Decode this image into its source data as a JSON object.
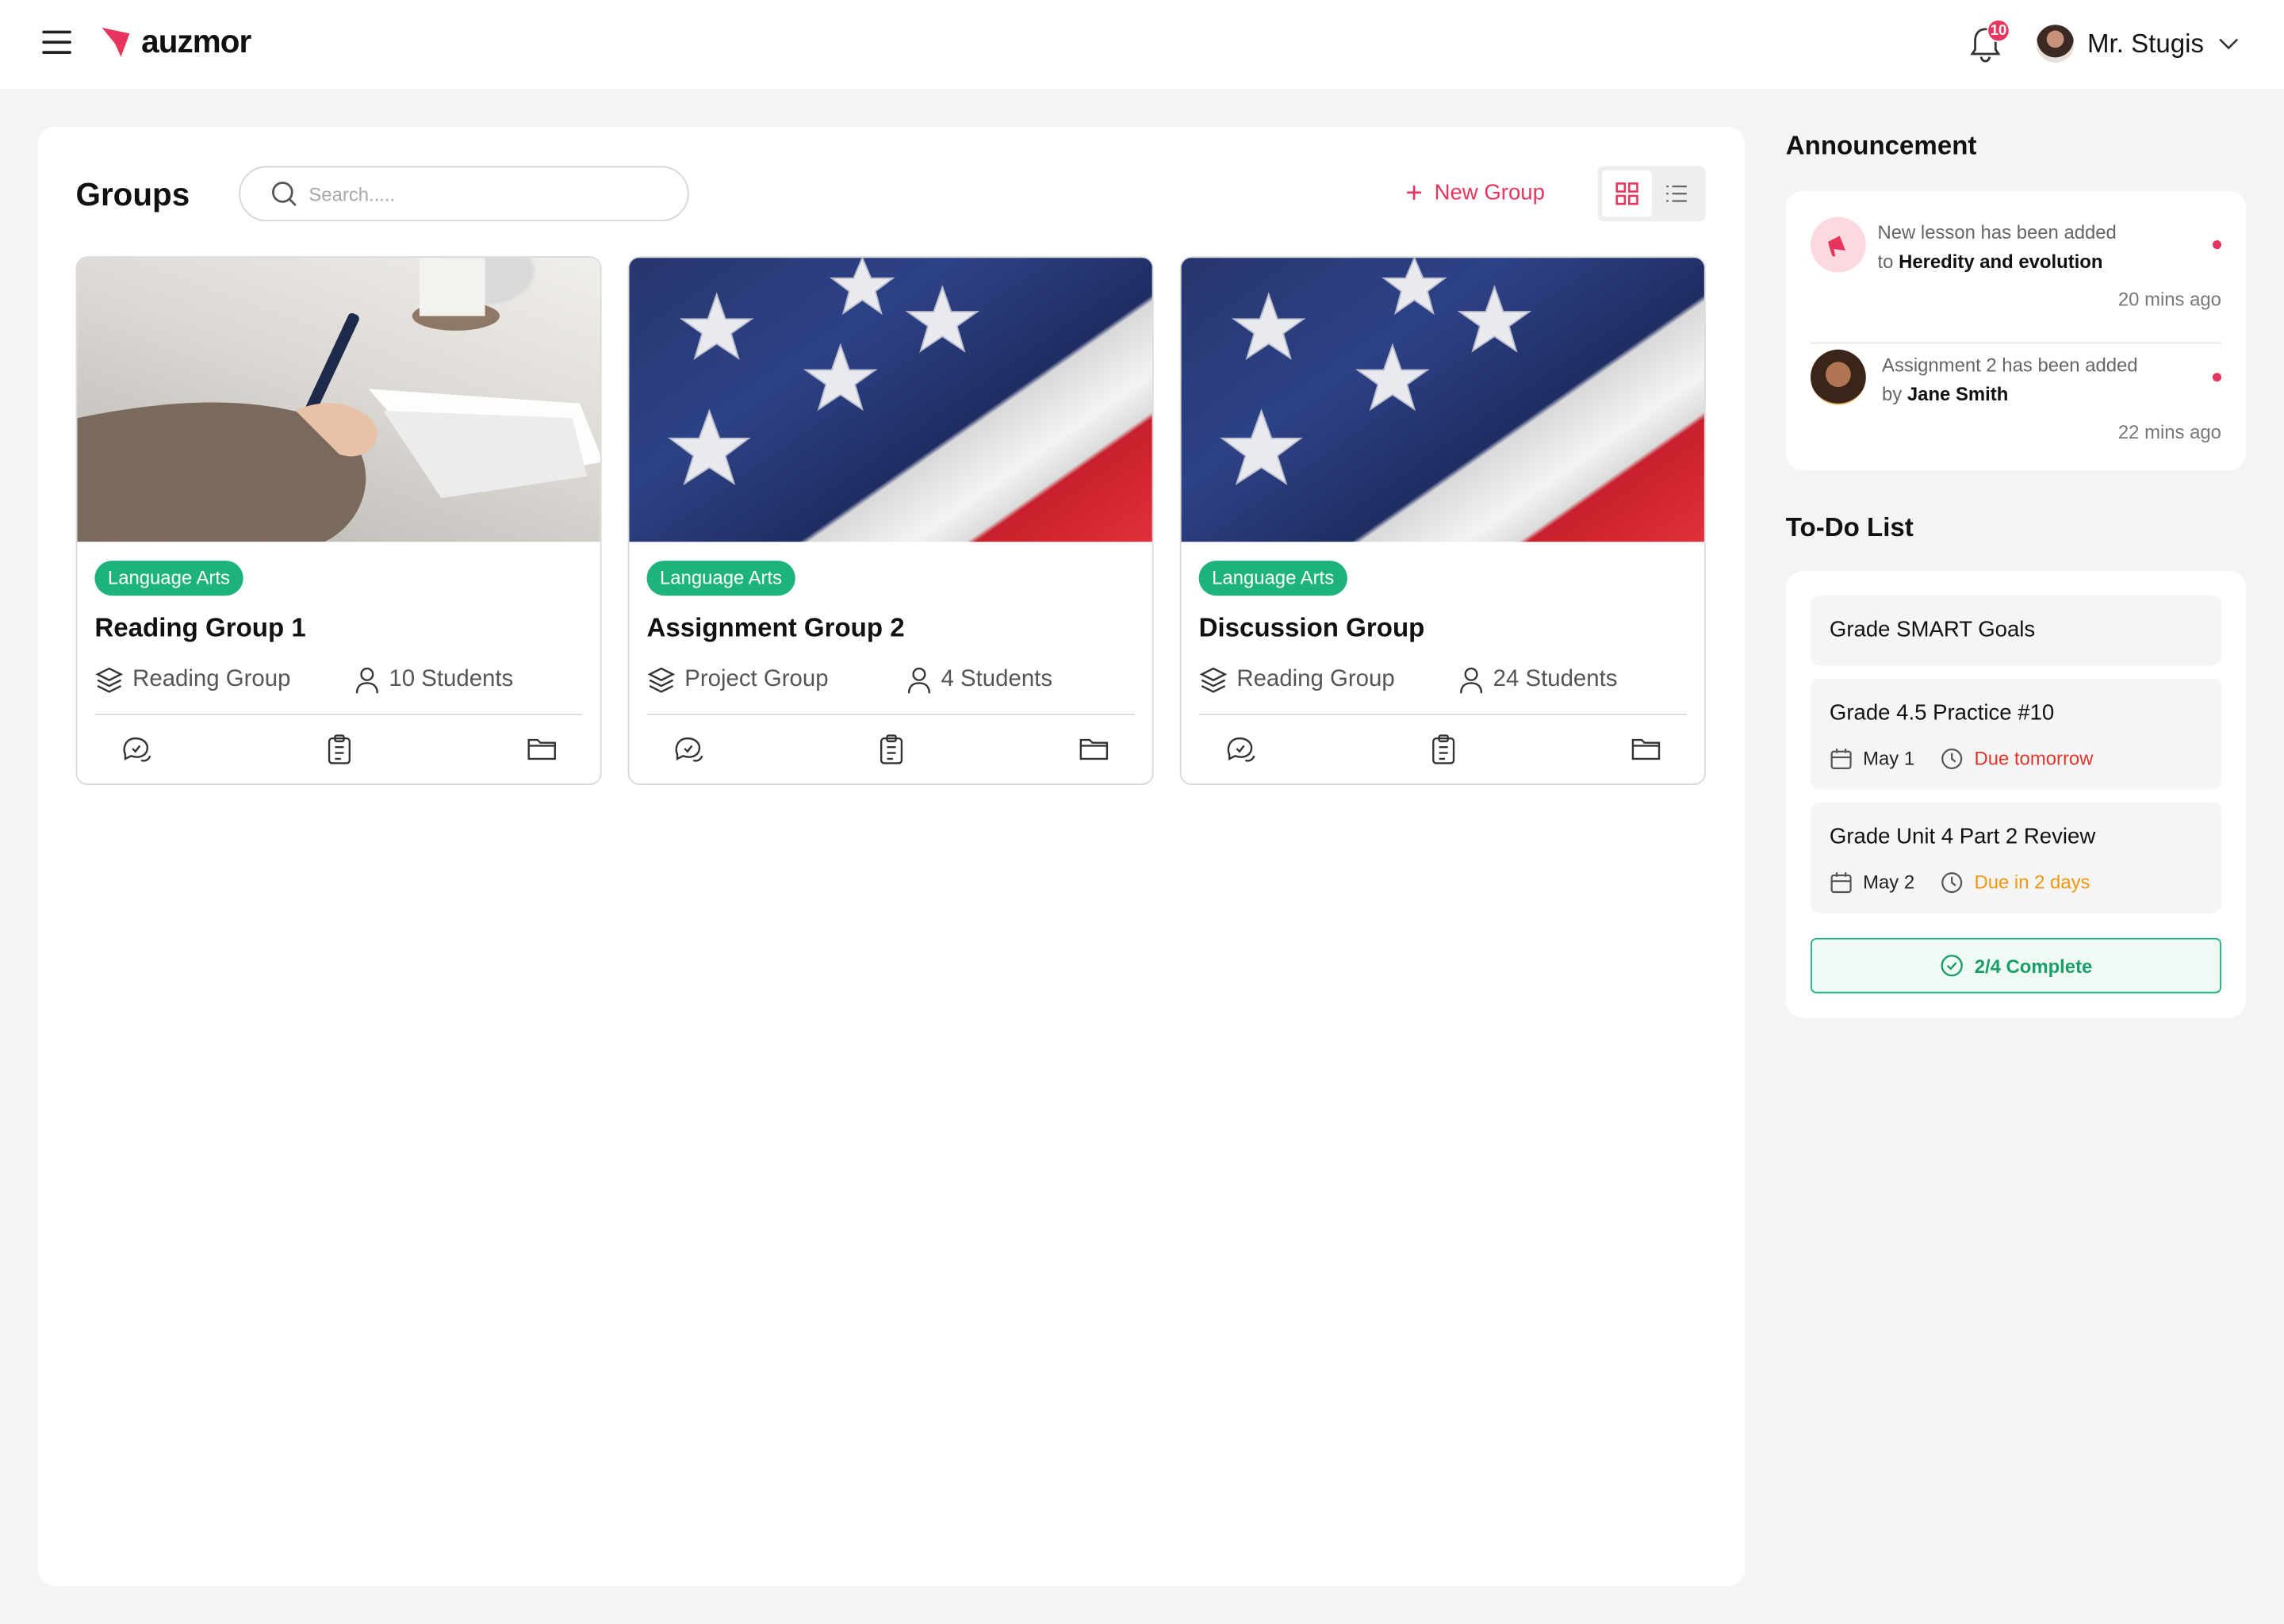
{
  "app": {
    "logo_text": "auzmor"
  },
  "header": {
    "notification_count": "10",
    "user_name": "Mr. Stugis"
  },
  "groups": {
    "title": "Groups",
    "search_placeholder": "Search.....",
    "new_group_label": "New Group",
    "cards": [
      {
        "tag": "Language Arts",
        "title": "Reading Group 1",
        "type": "Reading Group",
        "students": "10 Students"
      },
      {
        "tag": "Language Arts",
        "title": "Assignment Group 2",
        "type": "Project Group",
        "students": "4 Students"
      },
      {
        "tag": "Language Arts",
        "title": "Discussion Group",
        "type": "Reading Group",
        "students": "24 Students"
      }
    ]
  },
  "announcements": {
    "title": "Announcement",
    "items": [
      {
        "line1": "New lesson has been added",
        "prefix": "to",
        "highlight": "Heredity and evolution",
        "time": "20 mins ago"
      },
      {
        "line1": "Assignment 2 has been added",
        "prefix": "by",
        "highlight": "Jane Smith",
        "time": "22 mins ago"
      }
    ]
  },
  "todo": {
    "title": "To-Do List",
    "items": [
      {
        "title": "Grade SMART Goals"
      },
      {
        "title": "Grade 4.5 Practice #10",
        "date": "May 1",
        "due": "Due tomorrow",
        "due_color": "#e0352b"
      },
      {
        "title": "Grade Unit 4 Part 2 Review",
        "date": "May 2",
        "due": "Due in 2 days",
        "due_color": "#f0960e"
      }
    ],
    "complete_label": "2/4 Complete"
  },
  "colors": {
    "accent": "#e8355d",
    "success": "#1db37a"
  }
}
